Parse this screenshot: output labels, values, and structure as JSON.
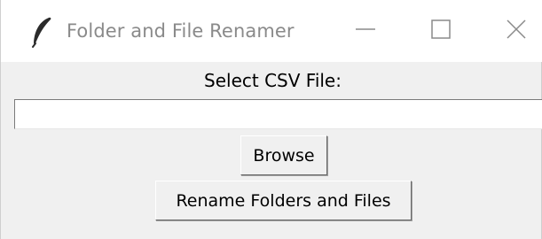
{
  "window": {
    "title": "Folder and File Renamer",
    "app_icon": "feather-icon",
    "controls": {
      "minimize_icon": "minimize-icon",
      "maximize_icon": "maximize-icon",
      "close_icon": "close-icon"
    }
  },
  "main": {
    "csv_label": "Select CSV File:",
    "csv_path_value": "",
    "browse_label": "Browse",
    "rename_label": "Rename Folders and Files"
  },
  "colors": {
    "titlebar_bg": "#ffffff",
    "window_bg": "#f0f0f0",
    "title_text": "#8a8a8a"
  }
}
